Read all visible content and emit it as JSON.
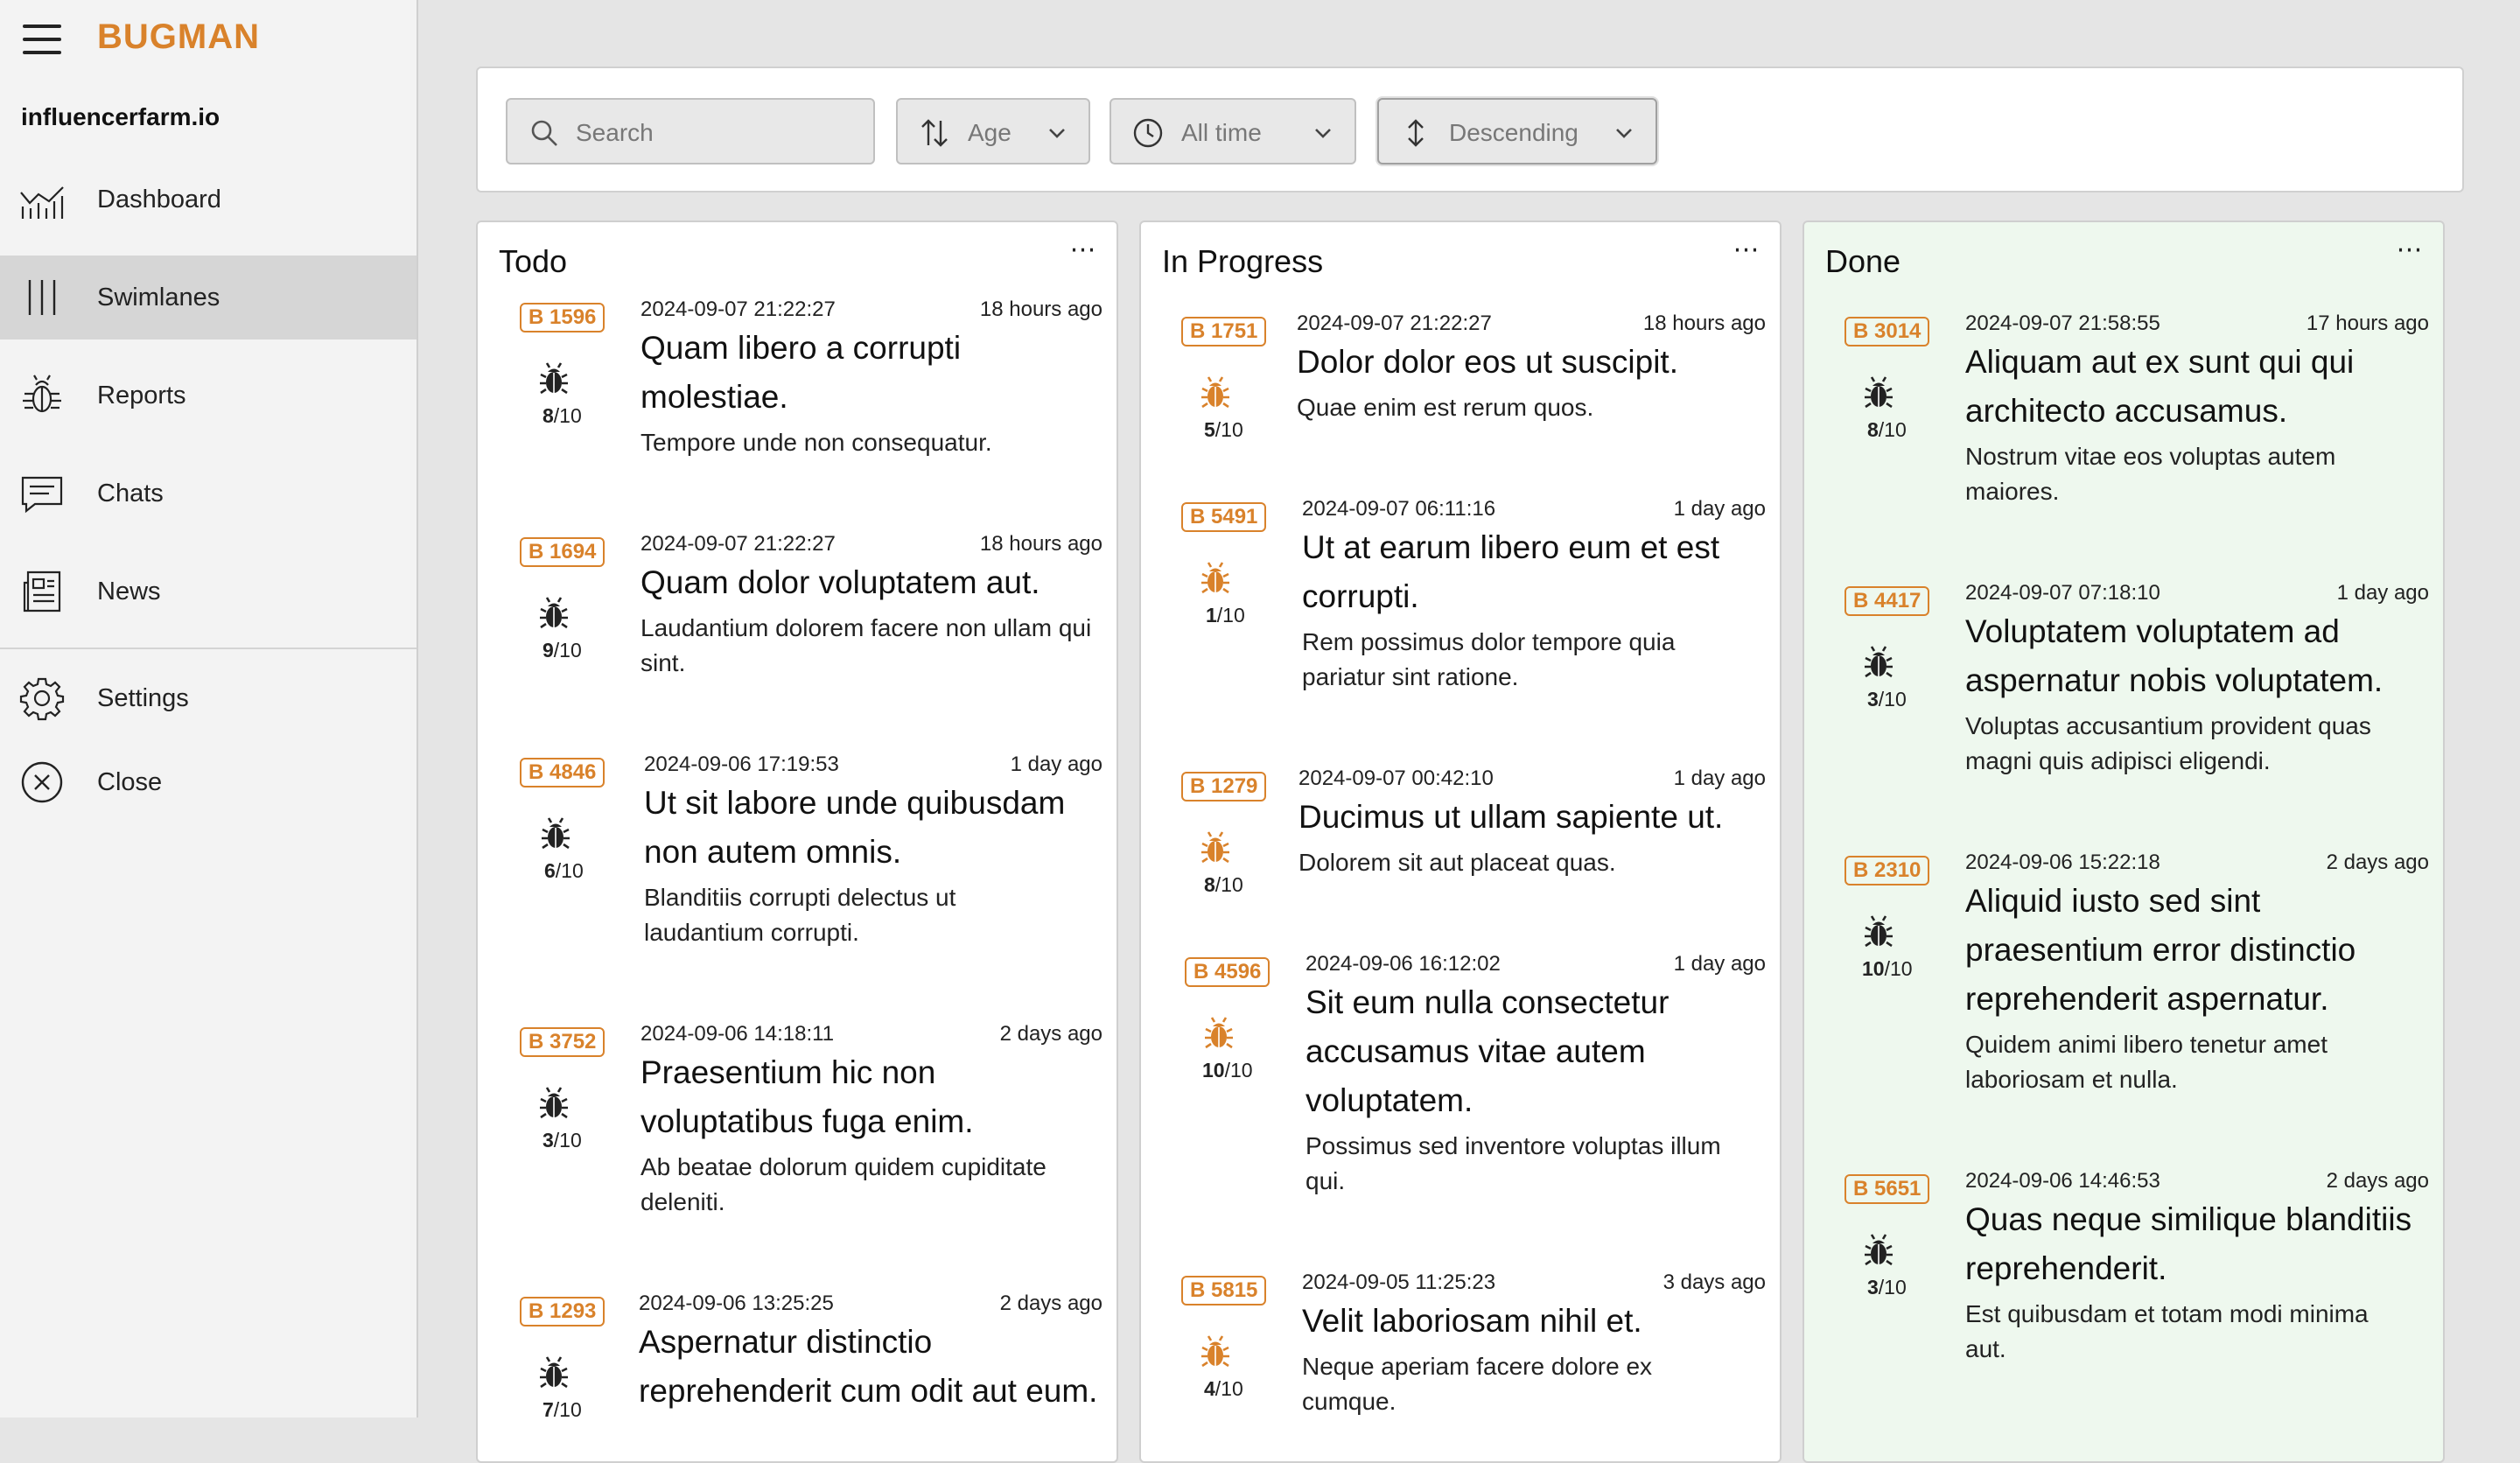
{
  "app": {
    "brand": "BUGMAN",
    "org": "influencerfarm.io"
  },
  "nav": [
    {
      "label": "Dashboard",
      "icon": "chart-line-icon"
    },
    {
      "label": "Swimlanes",
      "icon": "swimlanes-icon",
      "active": true
    },
    {
      "label": "Reports",
      "icon": "bug-icon"
    },
    {
      "label": "Chats",
      "icon": "chat-icon"
    },
    {
      "label": "News",
      "icon": "newspaper-icon"
    },
    {
      "label": "Settings",
      "icon": "gear-icon"
    },
    {
      "label": "Close",
      "icon": "close-circle-icon"
    }
  ],
  "toolbar": {
    "search_placeholder": "Search",
    "sort_field": "Age",
    "time_range": "All time",
    "order": "Descending"
  },
  "colors": {
    "accent": "#d9822b",
    "done_bg": "#eef8ee"
  },
  "columns": [
    {
      "title": "Todo",
      "cards": [
        {
          "id": "B 1596",
          "severity": "8",
          "date": "2024-09-07 21:22:27",
          "ago": "18 hours ago",
          "title": "Quam libero a corrupti molestiae.",
          "desc": "Tempore unde non consequatur."
        },
        {
          "id": "B 1694",
          "severity": "9",
          "date": "2024-09-07 21:22:27",
          "ago": "18 hours ago",
          "title": "Quam dolor voluptatem aut.",
          "desc": "Laudantium dolorem facere non ullam qui sint."
        },
        {
          "id": "B 4846",
          "severity": "6",
          "date": "2024-09-06 17:19:53",
          "ago": "1 day ago",
          "title": "Ut sit labore unde quibusdam non autem omnis.",
          "desc": "Blanditiis corrupti delectus ut laudantium corrupti."
        },
        {
          "id": "B 3752",
          "severity": "3",
          "date": "2024-09-06 14:18:11",
          "ago": "2 days ago",
          "title": "Praesentium hic non voluptatibus fuga enim.",
          "desc": "Ab beatae dolorum quidem cupiditate deleniti."
        },
        {
          "id": "B 1293",
          "severity": "7",
          "date": "2024-09-06 13:25:25",
          "ago": "2 days ago",
          "title": "Aspernatur distinctio reprehenderit cum odit aut eum.",
          "desc": ""
        }
      ]
    },
    {
      "title": "In Progress",
      "cards": [
        {
          "id": "B 1751",
          "severity": "5",
          "date": "2024-09-07 21:22:27",
          "ago": "18 hours ago",
          "title": "Dolor dolor eos ut suscipit.",
          "desc": "Quae enim est rerum quos."
        },
        {
          "id": "B 5491",
          "severity": "1",
          "date": "2024-09-07 06:11:16",
          "ago": "1 day ago",
          "title": "Ut at earum libero eum et est corrupti.",
          "desc": "Rem possimus dolor tempore quia pariatur sint ratione."
        },
        {
          "id": "B 1279",
          "severity": "8",
          "date": "2024-09-07 00:42:10",
          "ago": "1 day ago",
          "title": "Ducimus ut ullam sapiente ut.",
          "desc": "Dolorem sit aut placeat quas."
        },
        {
          "id": "B 4596",
          "severity": "10",
          "date": "2024-09-06 16:12:02",
          "ago": "1 day ago",
          "title": "Sit eum nulla consectetur accusamus vitae autem voluptatem.",
          "desc": "Possimus sed inventore voluptas illum qui."
        },
        {
          "id": "B 5815",
          "severity": "4",
          "date": "2024-09-05 11:25:23",
          "ago": "3 days ago",
          "title": "Velit laboriosam nihil et.",
          "desc": "Neque aperiam facere dolore ex cumque."
        }
      ]
    },
    {
      "title": "Done",
      "cards": [
        {
          "id": "B 3014",
          "severity": "8",
          "date": "2024-09-07 21:58:55",
          "ago": "17 hours ago",
          "title": "Aliquam aut ex sunt qui qui architecto accusamus.",
          "desc": "Nostrum vitae eos voluptas autem maiores."
        },
        {
          "id": "B 4417",
          "severity": "3",
          "date": "2024-09-07 07:18:10",
          "ago": "1 day ago",
          "title": "Voluptatem voluptatem ad aspernatur nobis voluptatem.",
          "desc": "Voluptas accusantium provident quas magni quis adipisci eligendi."
        },
        {
          "id": "B 2310",
          "severity": "10",
          "date": "2024-09-06 15:22:18",
          "ago": "2 days ago",
          "title": "Aliquid iusto sed sint praesentium error distinctio reprehenderit aspernatur.",
          "desc": "Quidem animi libero tenetur amet laboriosam et nulla."
        },
        {
          "id": "B 5651",
          "severity": "3",
          "date": "2024-09-06 14:46:53",
          "ago": "2 days ago",
          "title": "Quas neque similique blanditiis reprehenderit.",
          "desc": "Est quibusdam et totam modi minima aut."
        }
      ]
    }
  ],
  "severity_scale": "/10"
}
